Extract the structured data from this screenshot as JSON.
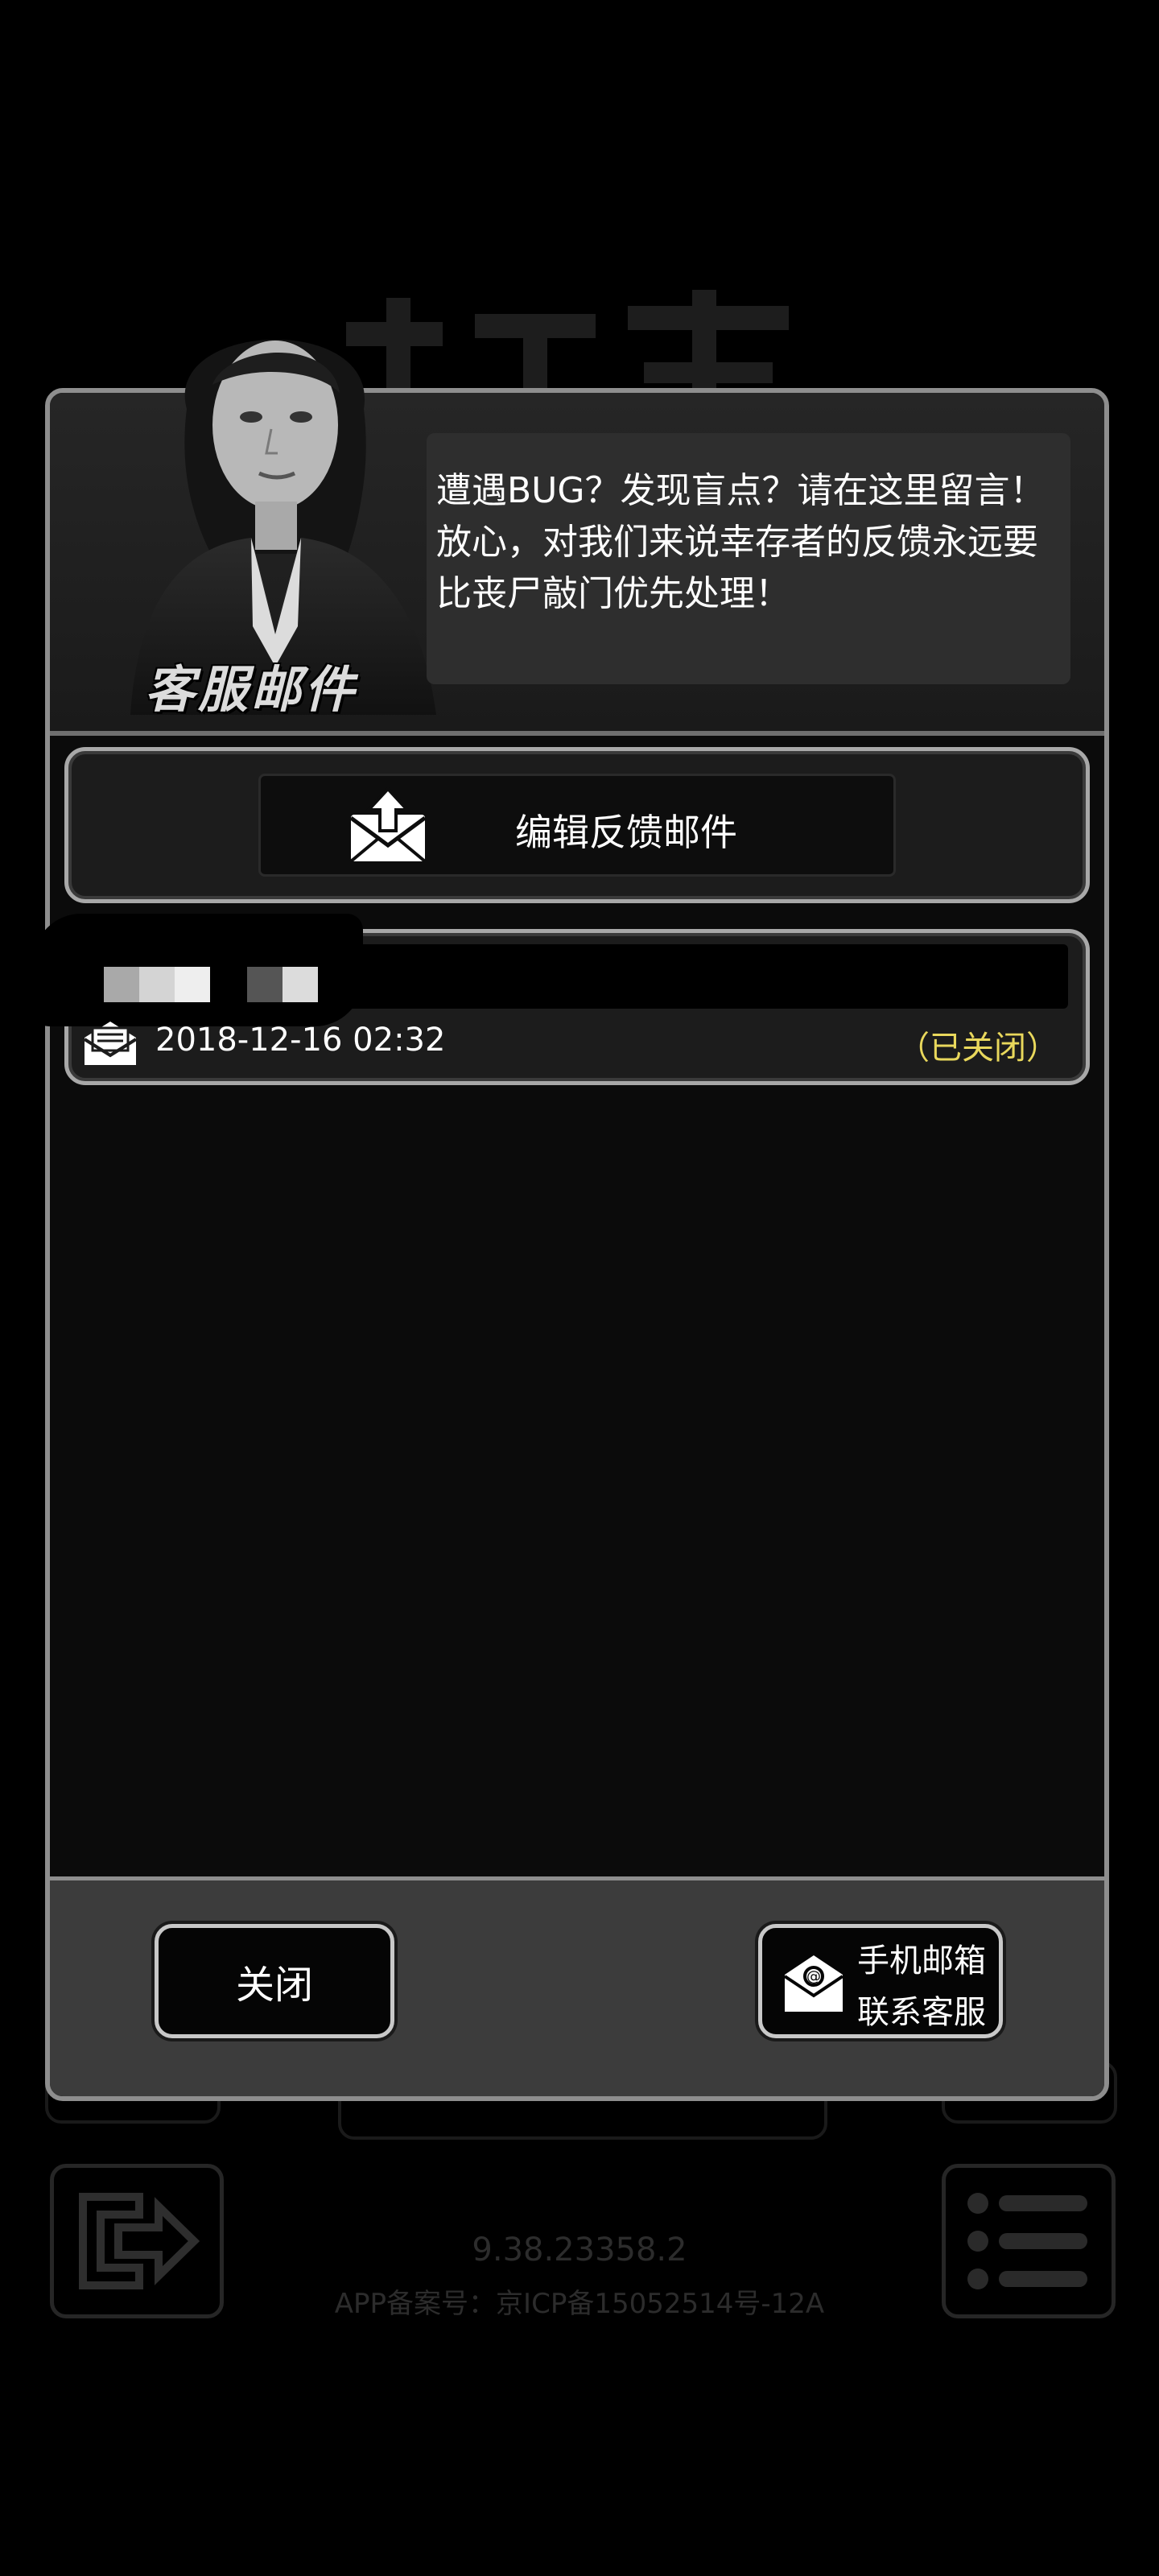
{
  "background": {
    "version": "9.38.23358.2",
    "icp": "APP备案号：京ICP备15052514号-12A"
  },
  "dialog": {
    "header_title": "客服邮件",
    "speech_text": "遭遇BUG？发现盲点？请在这里留言！放心，对我们来说幸存者的反馈永远要比丧尸敲门优先处理！",
    "compose_label": "编辑反馈邮件",
    "mails": [
      {
        "date": "2018-12-16 02:32",
        "status": "（已关闭）"
      }
    ],
    "footer": {
      "close_label": "关闭",
      "contact_line1": "手机邮箱",
      "contact_line2": "联系客服"
    }
  },
  "colors": {
    "status_closed": "#e9d85c",
    "border": "#a8a8a8",
    "footer_bg": "#3c3c3c"
  }
}
